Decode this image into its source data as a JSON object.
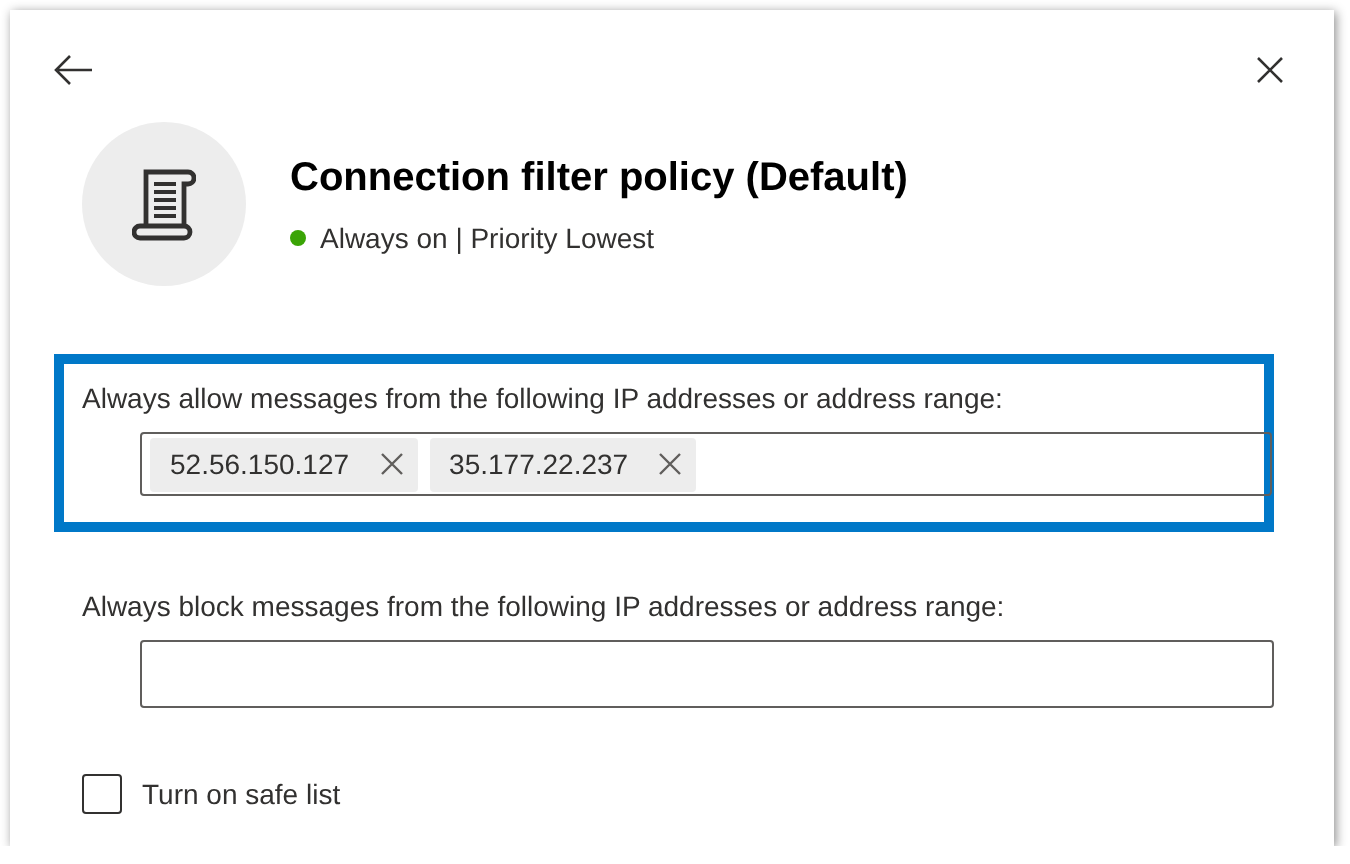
{
  "title": "Connection filter policy (Default)",
  "status": {
    "text": "Always on | Priority Lowest",
    "color": "#3aa406"
  },
  "allow": {
    "label": "Always allow messages from the following IP addresses or address range:",
    "highlighted": true,
    "entries": [
      "52.56.150.127",
      "35.177.22.237"
    ]
  },
  "block": {
    "label": "Always block messages from the following IP addresses or address range:",
    "highlighted": false
  },
  "safe_list": {
    "label": "Turn on safe list",
    "checked": false
  }
}
